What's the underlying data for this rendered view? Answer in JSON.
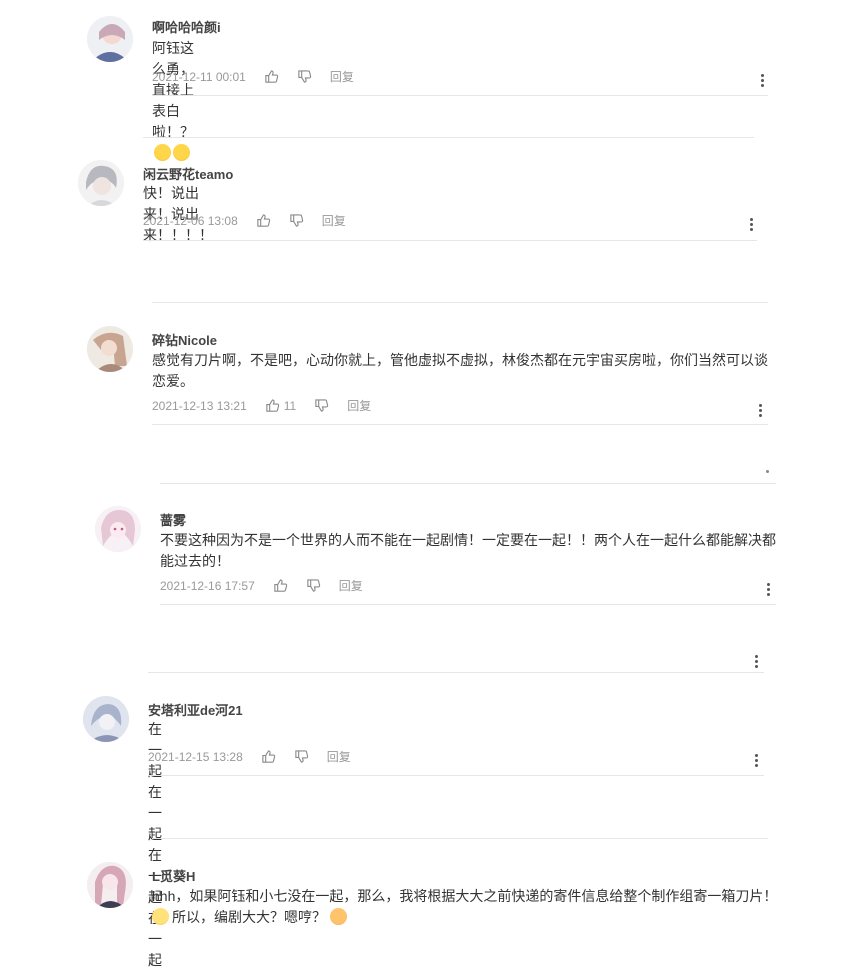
{
  "comments": [
    {
      "user": "啊哈哈哈颜i",
      "text": "阿钰这么勇，直接上表白啦！？",
      "time": "2021-12-11 00:01",
      "likes": "",
      "reply": "回复",
      "avatar_color": "#c9a9b8"
    },
    {
      "user": "闲云野花teamo",
      "text": "快！说出来！说出来！！！！",
      "time": "2021-12-06 13:08",
      "likes": "",
      "reply": "回复",
      "avatar_color": "#b8b8c0"
    },
    {
      "user": "碎钻Nicole",
      "text": "感觉有刀片啊，不是吧，心动你就上，管他虚拟不虚拟，林俊杰都在元宇宙买房啦，你们当然可以谈恋爱。",
      "time": "2021-12-13 13:21",
      "likes": "11",
      "reply": "回复",
      "avatar_color": "#c7a590"
    },
    {
      "user": "蔷雾",
      "text": "不要这种因为不是一个世界的人而不能在一起剧情！一定要在一起！！两个人在一起什么都能解决都能过去的！",
      "time": "2021-12-16 17:57",
      "likes": "",
      "reply": "回复",
      "avatar_color": "#e6c7d6"
    },
    {
      "user": "安塔利亚de河21",
      "text": "在一起在一起在一起在一起",
      "time": "2021-12-15 13:28",
      "likes": "",
      "reply": "回复",
      "avatar_color": "#a9b4cc"
    },
    {
      "user": "L觅葵H",
      "text": "hhh，如果阿钰和小七没在一起，那么，我将根据大大之前快递的寄件信息给整个制作组寄一箱刀片！",
      "text2": "所以，编剧大大？嗯哼？",
      "avatar_color": "#d6a7b6"
    }
  ]
}
